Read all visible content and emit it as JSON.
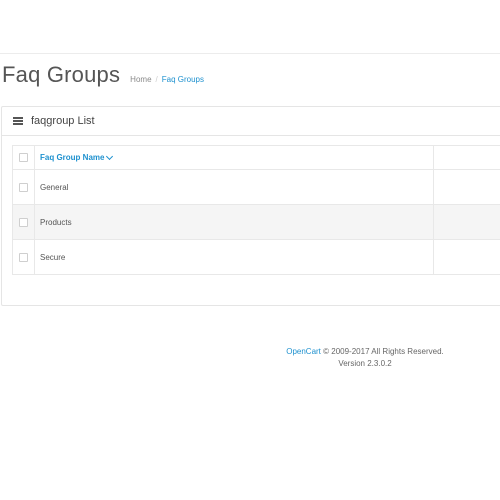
{
  "header": {
    "title": "Faq Groups",
    "breadcrumb": [
      {
        "label": "Home"
      },
      {
        "label": "Faq Groups"
      }
    ],
    "breadcrumb_separator": "/"
  },
  "panel": {
    "title": "faqgroup List",
    "icon": "list-icon"
  },
  "table": {
    "column_name_header": "Faq Group Name",
    "sort_icon": "caret-down-icon",
    "rows": [
      {
        "name": "General"
      },
      {
        "name": "Products"
      },
      {
        "name": "Secure"
      }
    ]
  },
  "footer": {
    "brand": "OpenCart",
    "copyright": "© 2009-2017 All Rights Reserved.",
    "version": "Version 2.3.0.2"
  },
  "colors": {
    "link": "#1e91cf",
    "title_text": "#555555",
    "stripe": "#f5f5f5",
    "border": "#e5e5e5"
  }
}
